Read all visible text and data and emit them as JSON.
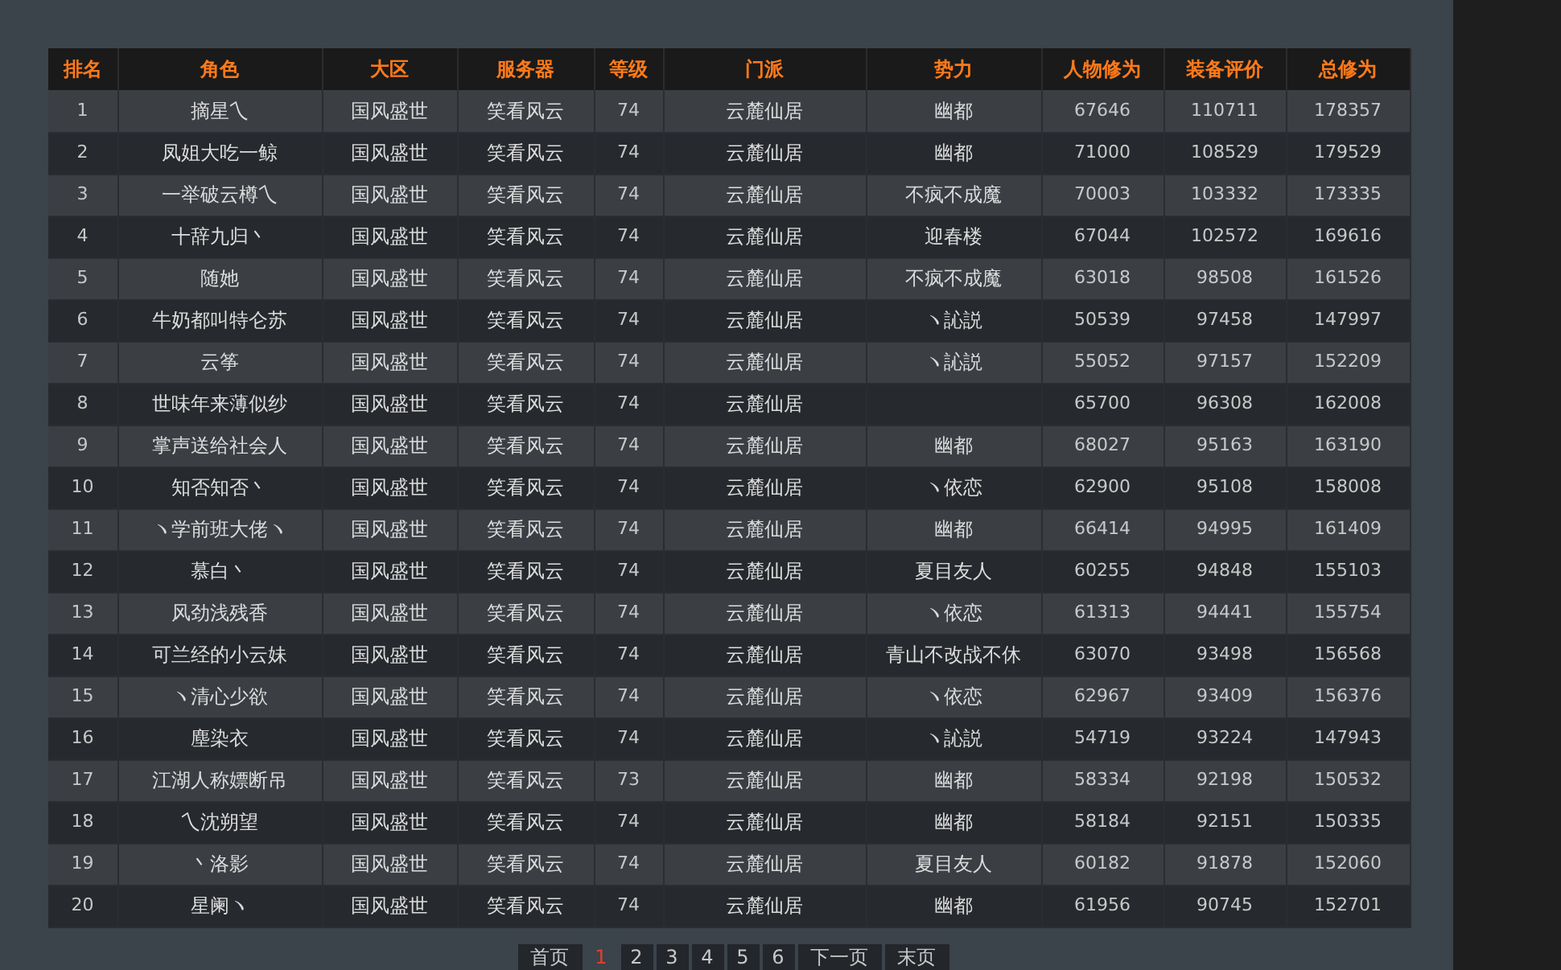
{
  "table": {
    "columns": [
      "排名",
      "角色",
      "大区",
      "服务器",
      "等级",
      "门派",
      "势力",
      "人物修为",
      "装备评价",
      "总修为"
    ],
    "rows": [
      {
        "rank": "1",
        "role": "摘星乀",
        "region": "国风盛世",
        "server": "笑看风云",
        "level": "74",
        "sect": "云麓仙居",
        "faction": "幽都",
        "cultivation": "67646",
        "equipment": "110711",
        "total": "178357"
      },
      {
        "rank": "2",
        "role": "凤姐大吃一鲸",
        "region": "国风盛世",
        "server": "笑看风云",
        "level": "74",
        "sect": "云麓仙居",
        "faction": "幽都",
        "cultivation": "71000",
        "equipment": "108529",
        "total": "179529"
      },
      {
        "rank": "3",
        "role": "一举破云樽乀",
        "region": "国风盛世",
        "server": "笑看风云",
        "level": "74",
        "sect": "云麓仙居",
        "faction": "不疯不成魔",
        "cultivation": "70003",
        "equipment": "103332",
        "total": "173335"
      },
      {
        "rank": "4",
        "role": "十辞九归丶",
        "region": "国风盛世",
        "server": "笑看风云",
        "level": "74",
        "sect": "云麓仙居",
        "faction": "迎春楼",
        "cultivation": "67044",
        "equipment": "102572",
        "total": "169616"
      },
      {
        "rank": "5",
        "role": "随她",
        "region": "国风盛世",
        "server": "笑看风云",
        "level": "74",
        "sect": "云麓仙居",
        "faction": "不疯不成魔",
        "cultivation": "63018",
        "equipment": "98508",
        "total": "161526"
      },
      {
        "rank": "6",
        "role": "牛奶都叫特仑苏",
        "region": "国风盛世",
        "server": "笑看风云",
        "level": "74",
        "sect": "云麓仙居",
        "faction": "ヽ訫説",
        "cultivation": "50539",
        "equipment": "97458",
        "total": "147997"
      },
      {
        "rank": "7",
        "role": "云筝",
        "region": "国风盛世",
        "server": "笑看风云",
        "level": "74",
        "sect": "云麓仙居",
        "faction": "ヽ訫説",
        "cultivation": "55052",
        "equipment": "97157",
        "total": "152209"
      },
      {
        "rank": "8",
        "role": "世味年来薄似纱",
        "region": "国风盛世",
        "server": "笑看风云",
        "level": "74",
        "sect": "云麓仙居",
        "cultivation": "65700",
        "equipment": "96308",
        "total": "162008"
      },
      {
        "rank": "9",
        "role": "掌声送给社会人",
        "region": "国风盛世",
        "server": "笑看风云",
        "level": "74",
        "sect": "云麓仙居",
        "faction": "幽都",
        "cultivation": "68027",
        "equipment": "95163",
        "total": "163190"
      },
      {
        "rank": "10",
        "role": "知否知否丶",
        "region": "国风盛世",
        "server": "笑看风云",
        "level": "74",
        "sect": "云麓仙居",
        "faction": "ヽ依恋",
        "cultivation": "62900",
        "equipment": "95108",
        "total": "158008"
      },
      {
        "rank": "11",
        "role": "ヽ学前班大佬ヽ",
        "region": "国风盛世",
        "server": "笑看风云",
        "level": "74",
        "sect": "云麓仙居",
        "faction": "幽都",
        "cultivation": "66414",
        "equipment": "94995",
        "total": "161409"
      },
      {
        "rank": "12",
        "role": "慕白丶",
        "region": "国风盛世",
        "server": "笑看风云",
        "level": "74",
        "sect": "云麓仙居",
        "faction": "夏目友人",
        "cultivation": "60255",
        "equipment": "94848",
        "total": "155103"
      },
      {
        "rank": "13",
        "role": "风劲浅残香",
        "region": "国风盛世",
        "server": "笑看风云",
        "level": "74",
        "sect": "云麓仙居",
        "faction": "ヽ依恋",
        "cultivation": "61313",
        "equipment": "94441",
        "total": "155754"
      },
      {
        "rank": "14",
        "role": "可兰经的小云妹",
        "region": "国风盛世",
        "server": "笑看风云",
        "level": "74",
        "sect": "云麓仙居",
        "faction": "青山不改战不休",
        "cultivation": "63070",
        "equipment": "93498",
        "total": "156568"
      },
      {
        "rank": "15",
        "role": "ヽ清心少欲",
        "region": "国风盛世",
        "server": "笑看风云",
        "level": "74",
        "sect": "云麓仙居",
        "faction": "ヽ依恋",
        "cultivation": "62967",
        "equipment": "93409",
        "total": "156376"
      },
      {
        "rank": "16",
        "role": "塵染衣",
        "region": "国风盛世",
        "server": "笑看风云",
        "level": "74",
        "sect": "云麓仙居",
        "faction": "ヽ訫説",
        "cultivation": "54719",
        "equipment": "93224",
        "total": "147943"
      },
      {
        "rank": "17",
        "role": "江湖人称嫖断吊",
        "region": "国风盛世",
        "server": "笑看风云",
        "level": "73",
        "sect": "云麓仙居",
        "faction": "幽都",
        "cultivation": "58334",
        "equipment": "92198",
        "total": "150532"
      },
      {
        "rank": "18",
        "role": "乀沈朔望",
        "region": "国风盛世",
        "server": "笑看风云",
        "level": "74",
        "sect": "云麓仙居",
        "faction": "幽都",
        "cultivation": "58184",
        "equipment": "92151",
        "total": "150335"
      },
      {
        "rank": "19",
        "role": "丶洛影",
        "region": "国风盛世",
        "server": "笑看风云",
        "level": "74",
        "sect": "云麓仙居",
        "faction": "夏目友人",
        "cultivation": "60182",
        "equipment": "91878",
        "total": "152060"
      },
      {
        "rank": "20",
        "role": "星阑ヽ",
        "region": "国风盛世",
        "server": "笑看风云",
        "level": "74",
        "sect": "云麓仙居",
        "faction": "幽都",
        "cultivation": "61956",
        "equipment": "90745",
        "total": "152701"
      }
    ]
  },
  "pagination": [
    {
      "label": "首页",
      "kind": "nav",
      "selected": false
    },
    {
      "label": "1",
      "kind": "page",
      "selected": true
    },
    {
      "label": "2",
      "kind": "page",
      "selected": false
    },
    {
      "label": "3",
      "kind": "page",
      "selected": false
    },
    {
      "label": "4",
      "kind": "page",
      "selected": false
    },
    {
      "label": "5",
      "kind": "page",
      "selected": false
    },
    {
      "label": "6",
      "kind": "page",
      "selected": false
    },
    {
      "label": "下一页",
      "kind": "nav",
      "selected": false
    },
    {
      "label": "末页",
      "kind": "nav",
      "selected": false
    }
  ]
}
